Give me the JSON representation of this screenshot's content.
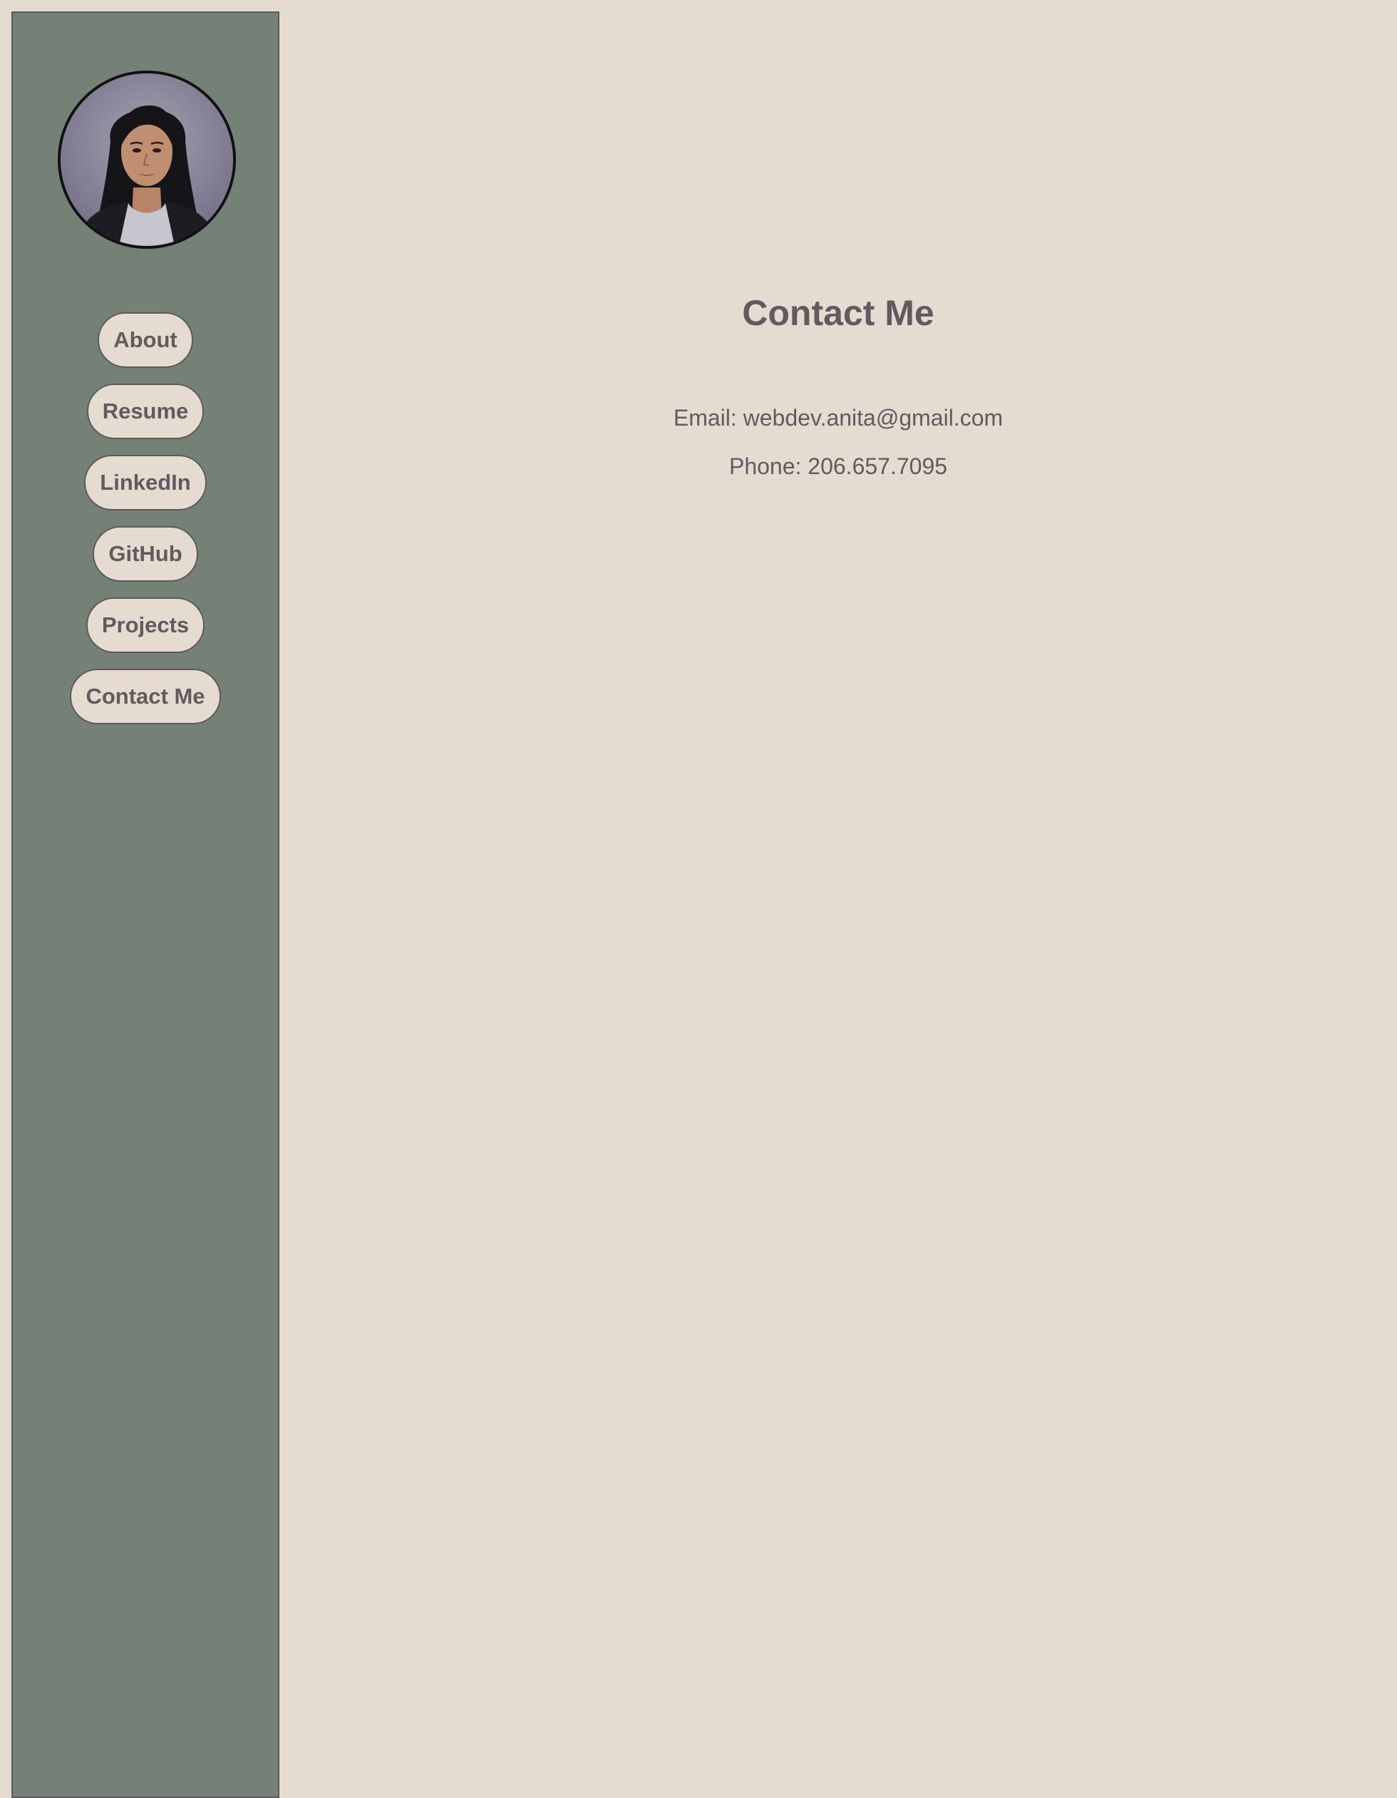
{
  "sidebar": {
    "avatar_icon": "profile-photo",
    "nav": [
      {
        "label": "About"
      },
      {
        "label": "Resume"
      },
      {
        "label": "LinkedIn"
      },
      {
        "label": "GitHub"
      },
      {
        "label": "Projects"
      },
      {
        "label": "Contact Me"
      }
    ]
  },
  "main": {
    "title": "Contact Me",
    "email_text": "Email: webdev.anita@gmail.com",
    "phone_text": "Phone: 206.657.7095"
  },
  "colors": {
    "page_background": "#e5dbd1",
    "sidebar_background": "#758176",
    "text": "#635a5f",
    "border": "#5c5a5d"
  }
}
